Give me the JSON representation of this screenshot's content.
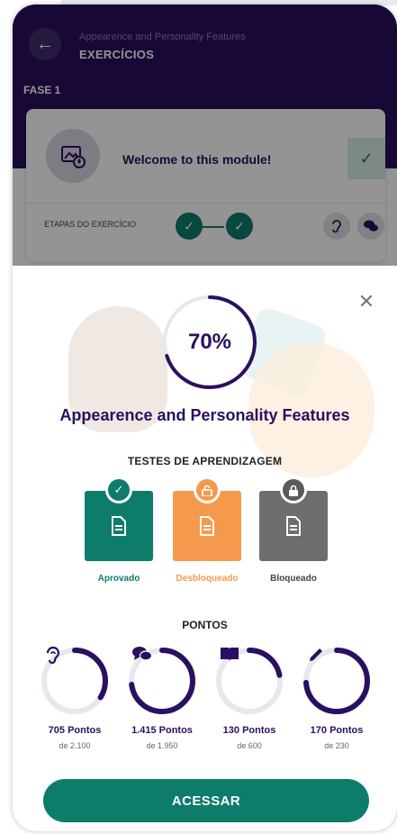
{
  "header": {
    "subtitle": "Appearence and Personality Features",
    "title": "EXERCÍCIOS",
    "phase": "FASE 1"
  },
  "module_card": {
    "title": "Welcome to this module!",
    "steps_label": "ETAPAS DO EXERCÍCIO"
  },
  "modal": {
    "progress_text": "70%",
    "progress_value": 0.7,
    "module_name": "Appearence and Personality Features",
    "tests_title": "TESTES DE APRENDIZAGEM",
    "tests": [
      {
        "label": "Aprovado",
        "color": "#0e7c6b"
      },
      {
        "label": "Desbloqueado",
        "color": "#f59a4c"
      },
      {
        "label": "Bloqueado",
        "color": "#6e6e6e"
      }
    ],
    "points_title": "PONTOS",
    "points": [
      {
        "value": "705 Pontos",
        "total": "de 2.100",
        "fraction": 0.34,
        "icon": "ear-icon"
      },
      {
        "value": "1.415 Pontos",
        "total": "de 1.950",
        "fraction": 0.73,
        "icon": "speech-bubbles-icon"
      },
      {
        "value": "130 Pontos",
        "total": "de 600",
        "fraction": 0.22,
        "icon": "book-icon"
      },
      {
        "value": "170 Pontos",
        "total": "de 230",
        "fraction": 0.74,
        "icon": "pencil-icon"
      }
    ],
    "access_label": "ACESSAR"
  },
  "colors": {
    "brand_purple": "#2a0f5c",
    "brand_green": "#0e7c6b",
    "unlocked_orange": "#f59a4c",
    "locked_gray": "#6e6e6e",
    "ring_track": "#e8e6ee"
  }
}
